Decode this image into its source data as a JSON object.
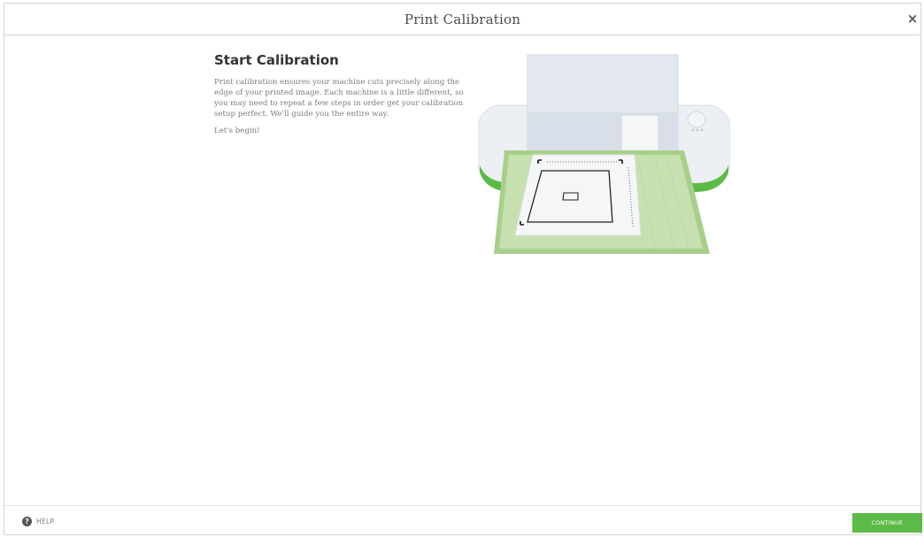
{
  "header": {
    "title": "Print Calibration",
    "close_icon": "×"
  },
  "content": {
    "heading": "Start Calibration",
    "paragraph": "Print calibration ensures your machine cuts precisely along the edge of your printed image. Each machine is a little different, so you may need to repeat a few steps in order get your calibration setup perfect. We'll guide you the entire way.",
    "prompt": "Let's begin!"
  },
  "illustration": {
    "name": "cutting-machine-with-calibration-sheet"
  },
  "footer": {
    "help_label": "HELP",
    "help_icon": "?",
    "continue_label": "CONTINUE"
  },
  "colors": {
    "accent": "#5cba47",
    "mat_green": "#a8cf8a"
  }
}
